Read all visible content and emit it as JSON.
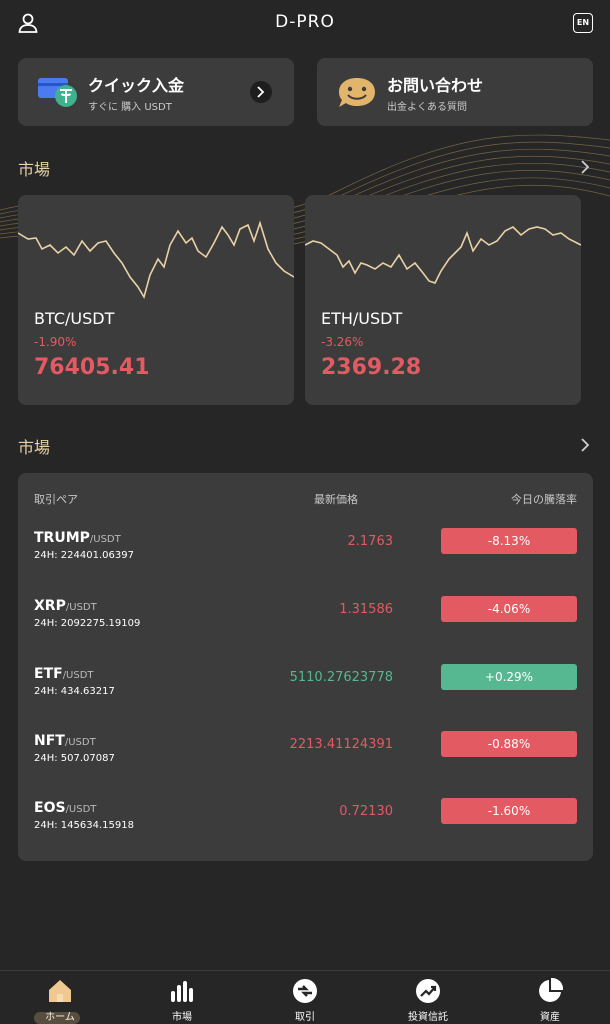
{
  "app": {
    "title": "D-PRO",
    "lang_badge": "EN"
  },
  "actions": {
    "deposit": {
      "label": "クイック入金",
      "sub": "すぐに 購入 USDT"
    },
    "support": {
      "label": "お問い合わせ",
      "sub": "出金よくある質問"
    }
  },
  "section1": {
    "title": "市場",
    "more": ""
  },
  "cards": [
    {
      "pair": "BTC/USDT",
      "change": "-1.90%",
      "price": "76405.41"
    },
    {
      "pair": "ETH/USDT",
      "change": "-3.26%",
      "price": "2369.28"
    }
  ],
  "section2": {
    "title": "市場"
  },
  "table": {
    "headers": {
      "pair": "取引ペア",
      "last": "最新価格",
      "change": "今日の騰落率"
    },
    "rows": [
      {
        "base": "TRUMP",
        "quote": "/USDT",
        "vol": "24H: 224401.06397",
        "last": "2.1763",
        "change": "-8.13%",
        "dir": "down"
      },
      {
        "base": "XRP",
        "quote": "/USDT",
        "vol": "24H: 2092275.19109",
        "last": "1.31586",
        "change": "-4.06%",
        "dir": "down"
      },
      {
        "base": "ETF",
        "quote": "/USDT",
        "vol": "24H: 434.63217",
        "last": "5110.27623778",
        "change": "+0.29%",
        "dir": "up"
      },
      {
        "base": "NFT",
        "quote": "/USDT",
        "vol": "24H: 507.07087",
        "last": "2213.41124391",
        "change": "-0.88%",
        "dir": "down"
      },
      {
        "base": "EOS",
        "quote": "/USDT",
        "vol": "24H: 145634.15918",
        "last": "0.72130",
        "change": "-1.60%",
        "dir": "down"
      }
    ]
  },
  "nav": {
    "home": "ホーム",
    "market": "市場",
    "trade": "取引",
    "fund": "投資信託",
    "assets": "資産"
  },
  "colors": {
    "accent": "#e8d2a6",
    "down": "#e35a62",
    "up": "#55b891",
    "card": "#3c3c3c",
    "bg": "#262626"
  }
}
